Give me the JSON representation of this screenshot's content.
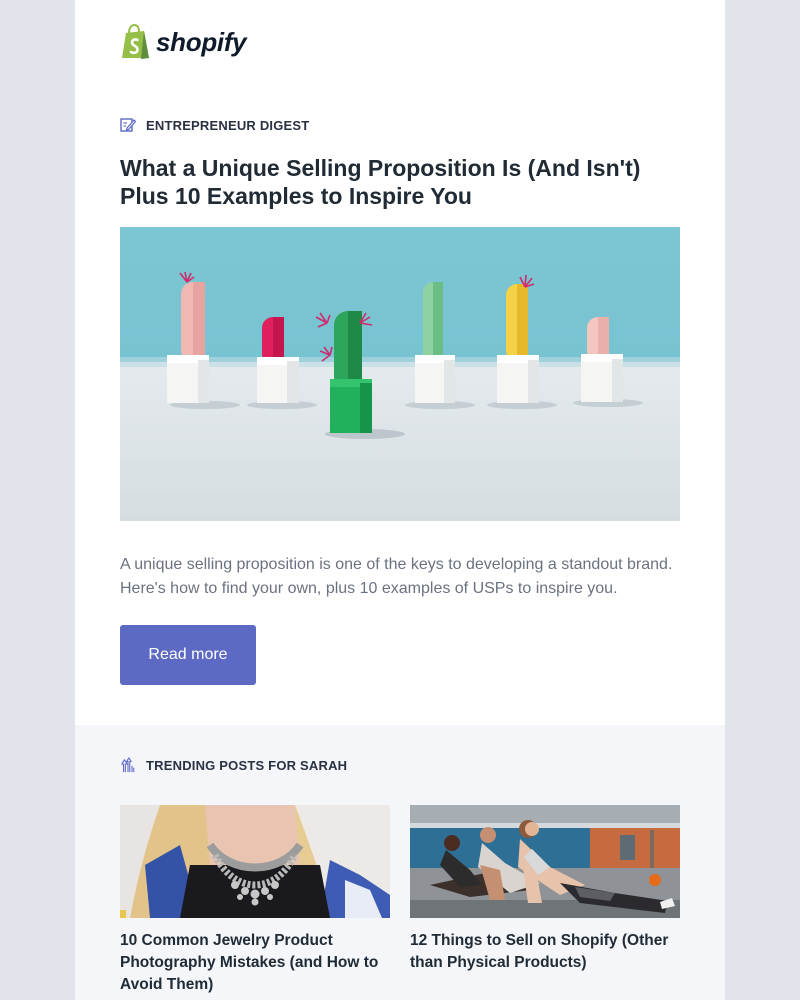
{
  "brand": {
    "name": "shopify",
    "logo_icon": "shopping-bag-icon",
    "brand_green": "#95bf47",
    "brand_dark_green": "#5e8e3e"
  },
  "digest": {
    "icon": "edit-note-icon",
    "label": "ENTREPRENEUR DIGEST"
  },
  "article": {
    "title": "What a Unique Selling Proposition Is (And Isn't) Plus 10 Examples to Inspire You",
    "summary": "A unique selling proposition is one of the keys to developing a standout brand. Here's how to find your own, plus 10 examples of USPs to inspire you.",
    "button_label": "Read more",
    "button_color": "#5c6ac4"
  },
  "trending": {
    "icon": "trending-arrows-icon",
    "label": "TRENDING POSTS FOR SARAH",
    "posts": [
      {
        "title": "10 Common Jewelry Product Photography Mistakes (and How to Avoid Them)"
      },
      {
        "title": "12 Things to Sell on Shopify (Other than Physical Products)"
      }
    ]
  }
}
